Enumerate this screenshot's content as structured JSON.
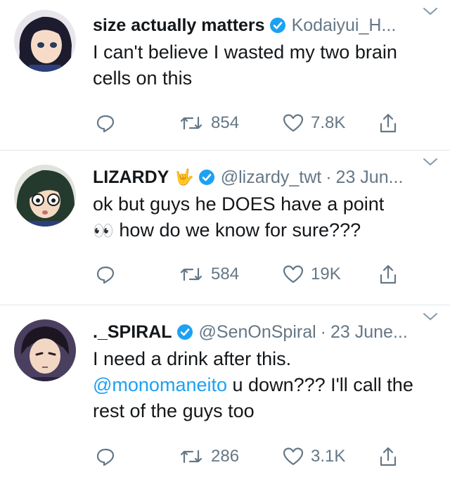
{
  "tweets": [
    {
      "name": "size actually matters",
      "handle": "Kodaiyui_H...",
      "date": "",
      "text_parts": [
        "I can't believe I wasted my two brain cells on this"
      ],
      "retweets": "854",
      "likes": "7.8K"
    },
    {
      "name": "LIZARDY",
      "name_emoji": "🤟",
      "handle": "@lizardy_twt",
      "date": "23 Jun...",
      "text_before_emoji": "ok but guys he DOES have a point",
      "emoji": "👀",
      "text_after_emoji": "how do we know for sure???",
      "retweets": "584",
      "likes": "19K"
    },
    {
      "name": "._SPIRAL",
      "handle": "@SenOnSpiral",
      "date": "23 June...",
      "text_line1": "I need a drink after this.",
      "mention": "@monomaneito",
      "text_after_mention": " u down??? I'll call the rest of the guys too",
      "retweets": "286",
      "likes": "3.1K"
    }
  ],
  "colors": {
    "accent": "#1da1f2",
    "muted": "#657786",
    "text": "#14171a",
    "divider": "#e1e8ed"
  },
  "icons": [
    "reply-icon",
    "retweet-icon",
    "like-icon",
    "share-icon",
    "verified-icon",
    "chevron-down-icon"
  ]
}
